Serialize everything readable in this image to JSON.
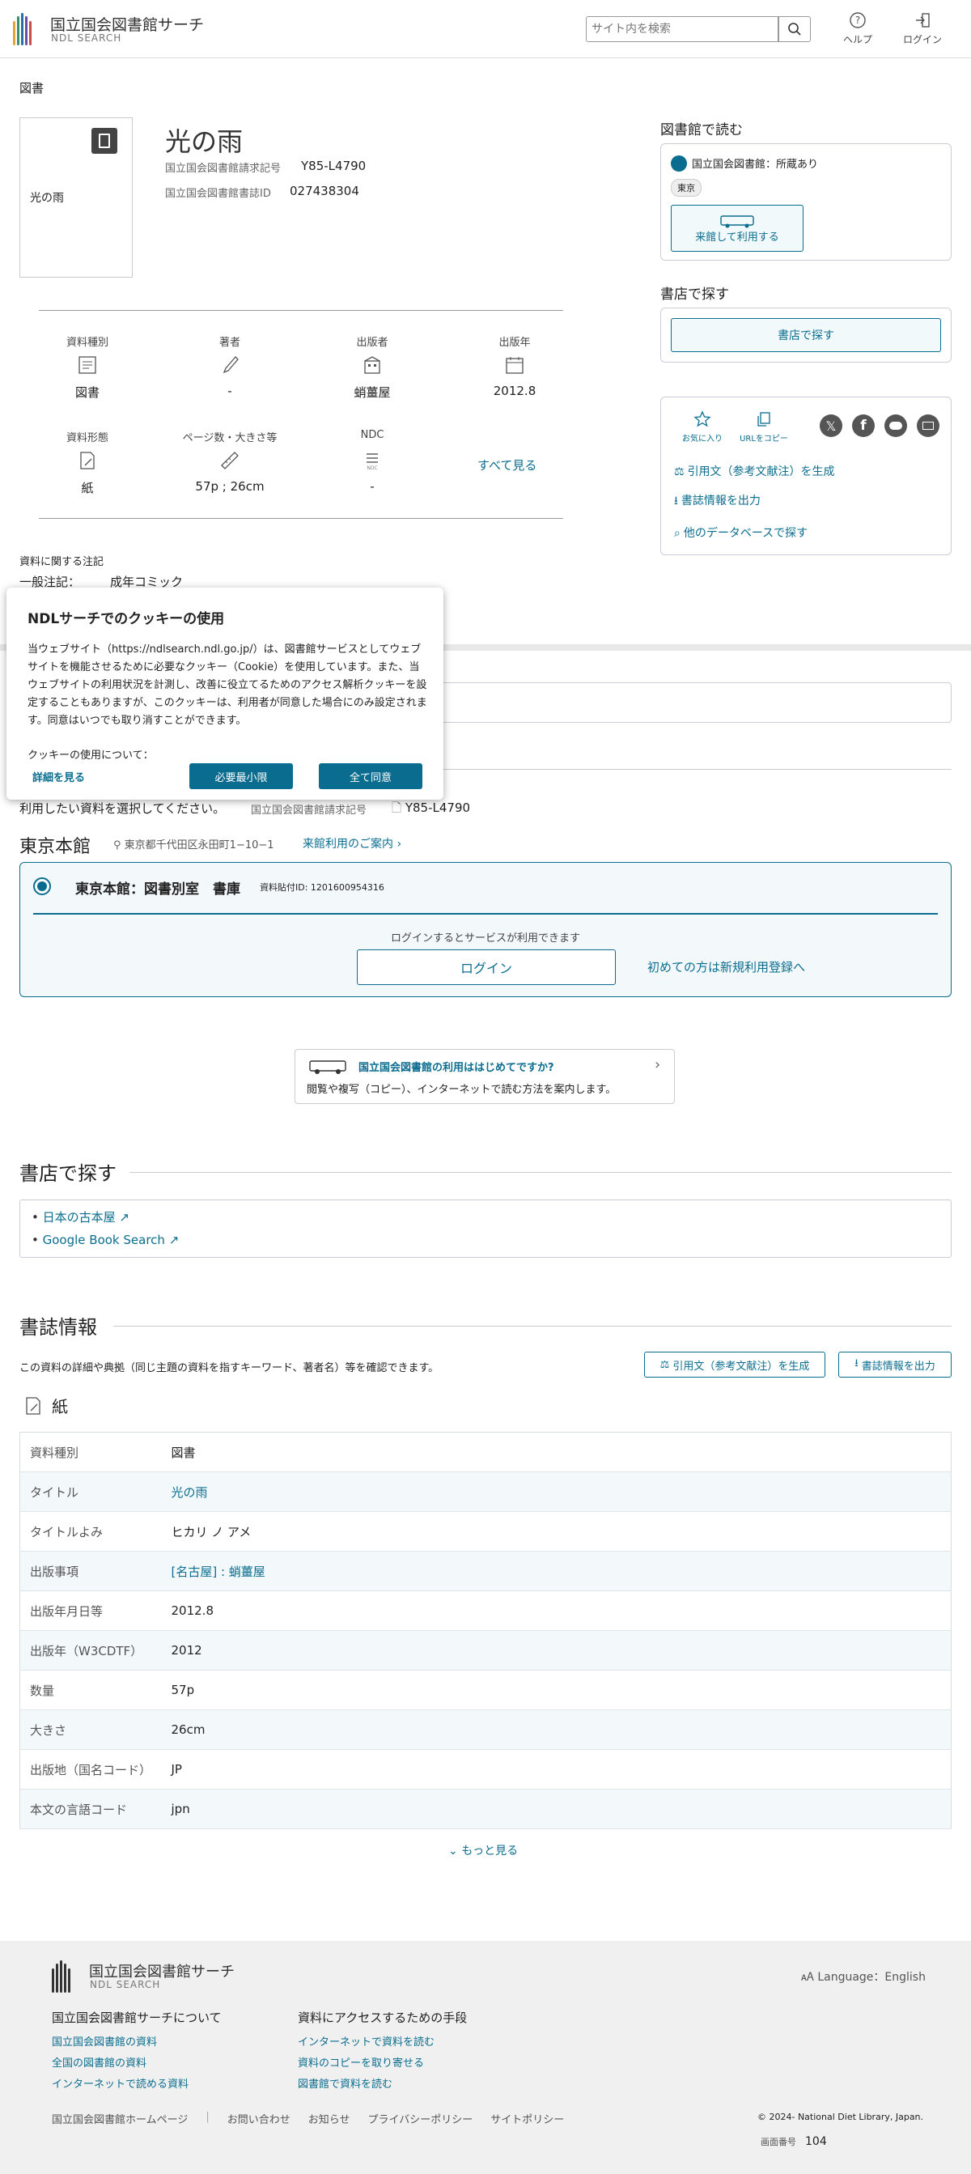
{
  "header": {
    "logo_jp": "国立国会図書館サーチ",
    "logo_en": "NDL SEARCH",
    "search_placeholder": "サイト内を検索",
    "help_label": "ヘルプ",
    "login_label": "ログイン"
  },
  "record": {
    "category": "図書",
    "cover_title": "光の雨",
    "title": "光の雨",
    "call_number_label": "国立国会図書館請求記号",
    "call_number": "Y85-L4790",
    "bib_id_label": "国立国会図書館書誌ID",
    "bib_id": "027438304"
  },
  "meta": {
    "items": [
      {
        "label": "資料種別",
        "value": "図書",
        "icon": "document-type-icon"
      },
      {
        "label": "著者",
        "value": "-",
        "icon": "pen-icon"
      },
      {
        "label": "出版者",
        "value": "蛸薑屋",
        "icon": "building-icon"
      },
      {
        "label": "出版年",
        "value": "2012.8",
        "icon": "calendar-icon"
      },
      {
        "label": "資料形態",
        "value": "紙",
        "icon": "paper-icon"
      },
      {
        "label": "ページ数・大きさ等",
        "value": "57p ; 26cm",
        "icon": "ruler-icon"
      },
      {
        "label": "NDC",
        "value": "-",
        "icon": "ndc-icon"
      }
    ],
    "see_all": "すべて見る"
  },
  "notes": {
    "heading": "資料に関する注記",
    "label": "一般注記：",
    "value": "成年コミック"
  },
  "right": {
    "read_title": "図書館で読む",
    "holding": "国立国会図書館：所蔵あり",
    "tag": "東京",
    "visit_btn": "来館して利用する",
    "shop_title": "書店で探す",
    "shop_btn": "書店で探す",
    "fav": "お気に入り",
    "copy_url": "URLをコピー",
    "cite": "引用文（参考文献注）を生成",
    "export": "書誌情報を出力",
    "other_db": "他のデータベースで探す"
  },
  "cookie": {
    "title": "NDLサーチでのクッキーの使用",
    "body": "当ウェブサイト（https://ndlsearch.ndl.go.jp/）は、図書館サービスとしてウェブサイトを機能させるために必要なクッキー（Cookie）を使用しています。また、当ウェブサイトの利用状況を計測し、改善に役立てるためのアクセス解析クッキーを設定することもありますが、このクッキーは、利用者が同意した場合にのみ設定されます。同意はいつでも取り消すことができます。",
    "usage": "クッキーの使用について：",
    "details": "詳細を見る",
    "min_btn": "必要最小限",
    "all_btn": "全て同意"
  },
  "use": {
    "select_text": "利用したい資料を選択してください。",
    "call_label": "国立国会図書館請求記号",
    "call_number": "Y85-L4790",
    "branch": "東京本館",
    "address": "東京都千代田区永田町1−10−1",
    "guide_link": "来館利用のご案内",
    "location": "東京本館：図書別室　書庫",
    "item_id": "資料貼付ID: 1201600954316",
    "login_note": "ログインするとサービスが利用できます",
    "login_btn": "ログイン",
    "register": "初めての方は新規利用登録へ",
    "banner_title": "国立国会図書館の利用ははじめてですか?",
    "banner_text": "閲覧や複写（コピー）、インターネットで読む方法を案内します。"
  },
  "shop": {
    "title": "書店で探す",
    "links": [
      "日本の古本屋",
      "Google Book Search"
    ]
  },
  "bib": {
    "title": "書誌情報",
    "desc": "この資料の詳細や典拠（同じ主題の資料を指すキーワード、著者名）等を確認できます。",
    "cite_btn": "引用文（参考文献注）を生成",
    "export_btn": "書誌情報を出力",
    "form": "紙",
    "rows": [
      {
        "k": "資料種別",
        "v": "図書"
      },
      {
        "k": "タイトル",
        "v": "光の雨"
      },
      {
        "k": "タイトルよみ",
        "v": "ヒカリ ノ アメ"
      },
      {
        "k": "出版事項",
        "v": "[名古屋] : 蛸薑屋"
      },
      {
        "k": "出版年月日等",
        "v": "2012.8"
      },
      {
        "k": "出版年（W3CDTF）",
        "v": "2012"
      },
      {
        "k": "数量",
        "v": "57p"
      },
      {
        "k": "大きさ",
        "v": "26cm"
      },
      {
        "k": "出版地（国名コード）",
        "v": "JP"
      },
      {
        "k": "本文の言語コード",
        "v": "jpn"
      }
    ],
    "more": "もっと見る"
  },
  "footer": {
    "logo_jp": "国立国会図書館サーチ",
    "logo_en": "NDL SEARCH",
    "lang": "Language：English",
    "col1_title": "国立国会図書館サーチについて",
    "col1": [
      "国立国会図書館の資料",
      "全国の図書館の資料",
      "インターネットで読める資料"
    ],
    "col2_title": "資料にアクセスするための手段",
    "col2": [
      "インターネットで資料を読む",
      "資料のコピーを取り寄せる",
      "図書館で資料を読む"
    ],
    "bottom": [
      "国立国会図書館ホームページ",
      "お問い合わせ",
      "お知らせ",
      "プライバシーポリシー",
      "サイトポリシー"
    ],
    "copyright": "© 2024- National Diet Library, Japan.",
    "screen_label": "画面番号",
    "screen_no": "104"
  },
  "colors": {
    "accent": "#0a6d8f",
    "accent_light": "#eef7fa",
    "footer_bg": "#f0f0f0"
  }
}
